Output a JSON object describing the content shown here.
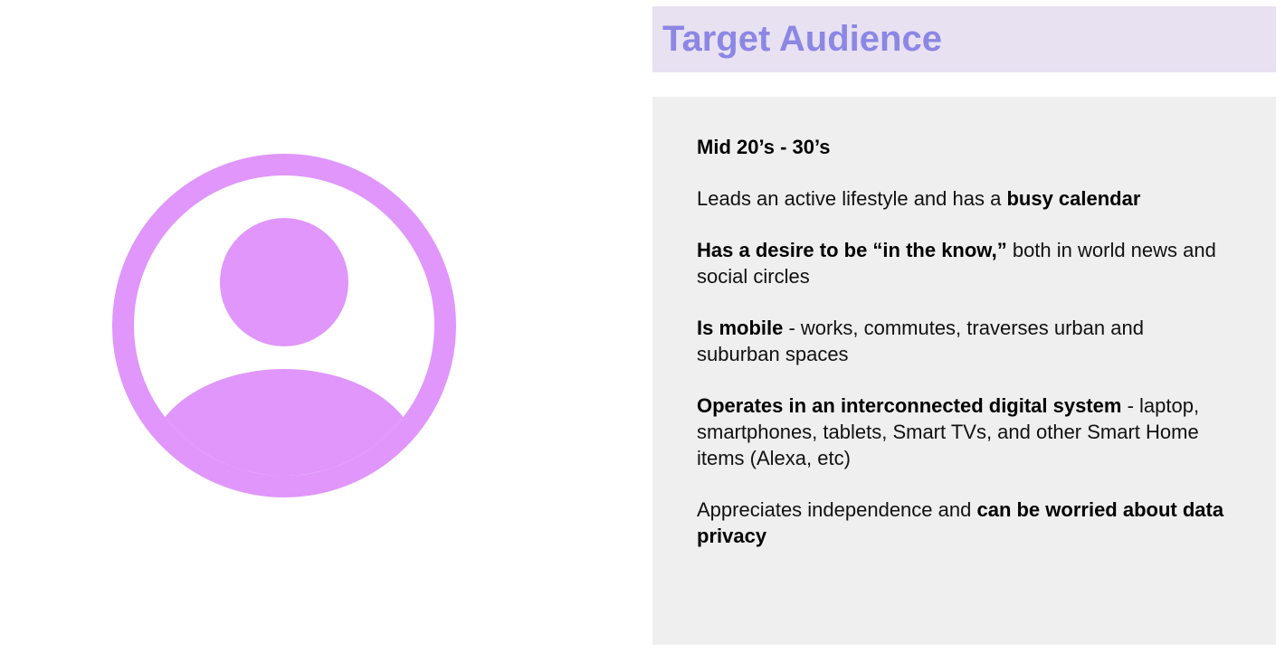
{
  "title": "Target Audience",
  "colors": {
    "title_text": "#8c86e4",
    "title_bar": "#e8e1f2",
    "content_bg": "#efefef",
    "avatar": "#e096fb"
  },
  "avatar": {
    "icon": "account-circle-icon"
  },
  "points": [
    {
      "bold": "Mid 20’s - 30’s"
    },
    {
      "text": "Leads an active lifestyle and has a ",
      "bold": "busy calendar"
    },
    {
      "bold": "Has a desire to be “in the know,”",
      "text": " both in world news and social circles"
    },
    {
      "bold": "Is mobile",
      "text": " - works, commutes, traverses urban and suburban spaces"
    },
    {
      "bold": "Operates in an interconnected digital system",
      "text": " - laptop, smartphones, tablets, Smart TVs, and other Smart Home items (Alexa, etc)"
    },
    {
      "text": "Appreciates independence and ",
      "bold": "can be worried about data privacy"
    }
  ]
}
